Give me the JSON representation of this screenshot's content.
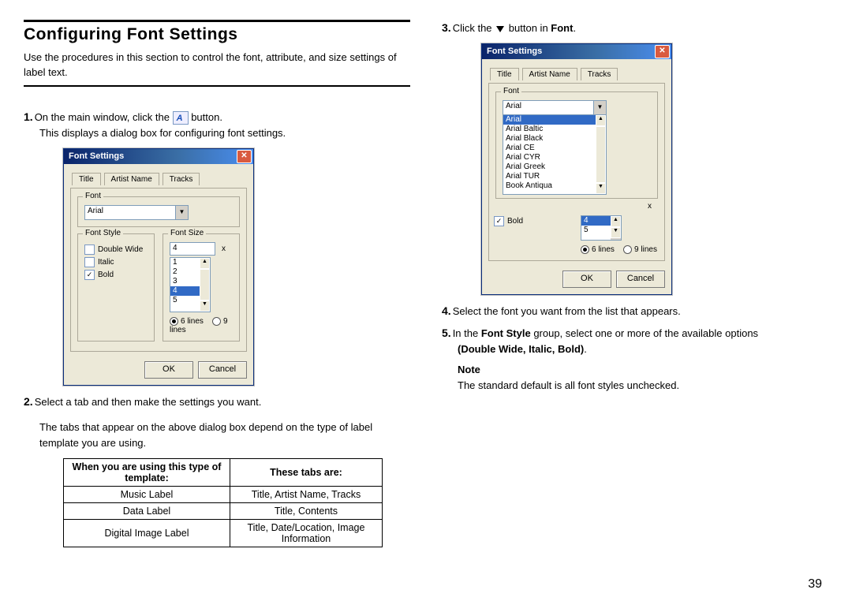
{
  "heading": "Configuring Font Settings",
  "intro": "Use the procedures in this section to control the font, attribute, and size settings of label text.",
  "step1_a": "On the main window, click the",
  "step1_b": "button.",
  "step1_sub": "This displays a dialog box for configuring font settings.",
  "step2": "Select a tab and then make the settings you want.",
  "step2_para": "The tabs that appear on the above dialog box depend on the type of label template you are using.",
  "step3_a": "Click the",
  "step3_b": "button in",
  "step3_c": "Font",
  "step4": "Select the font you want from the list that appears.",
  "step5_a": "In the",
  "step5_b": "Font Style",
  "step5_c": "group, select one or more of the available options",
  "step5_d": "(Double Wide, Italic, Bold)",
  "note_label": "Note",
  "note_text": "The standard default is all font styles unchecked.",
  "page_number": "39",
  "dialog": {
    "title": "Font Settings",
    "tabs": [
      "Title",
      "Artist Name",
      "Tracks"
    ],
    "font_legend": "Font",
    "font_value": "Arial",
    "fontstyle_legend": "Font Style",
    "cb_double": "Double Wide",
    "cb_italic": "Italic",
    "cb_bold": "Bold",
    "fontsize_legend": "Font Size",
    "size_value": "4",
    "size_x": "x",
    "size_items": [
      "1",
      "2",
      "3",
      "4",
      "5"
    ],
    "radio_6": "6 lines",
    "radio_9": "9 lines",
    "ok": "OK",
    "cancel": "Cancel"
  },
  "fonts_dropdown": [
    "Arial",
    "Arial",
    "Arial Baltic",
    "Arial Black",
    "Arial CE",
    "Arial CYR",
    "Arial Greek",
    "Arial TUR",
    "Book Antiqua"
  ],
  "table": {
    "h1": "When you are using this type of template:",
    "h2": "These tabs are:",
    "rows": [
      {
        "a": "Music Label",
        "b": "Title, Artist Name, Tracks"
      },
      {
        "a": "Data Label",
        "b": "Title, Contents"
      },
      {
        "a": "Digital Image Label",
        "b": "Title, Date/Location, Image Information"
      }
    ]
  }
}
